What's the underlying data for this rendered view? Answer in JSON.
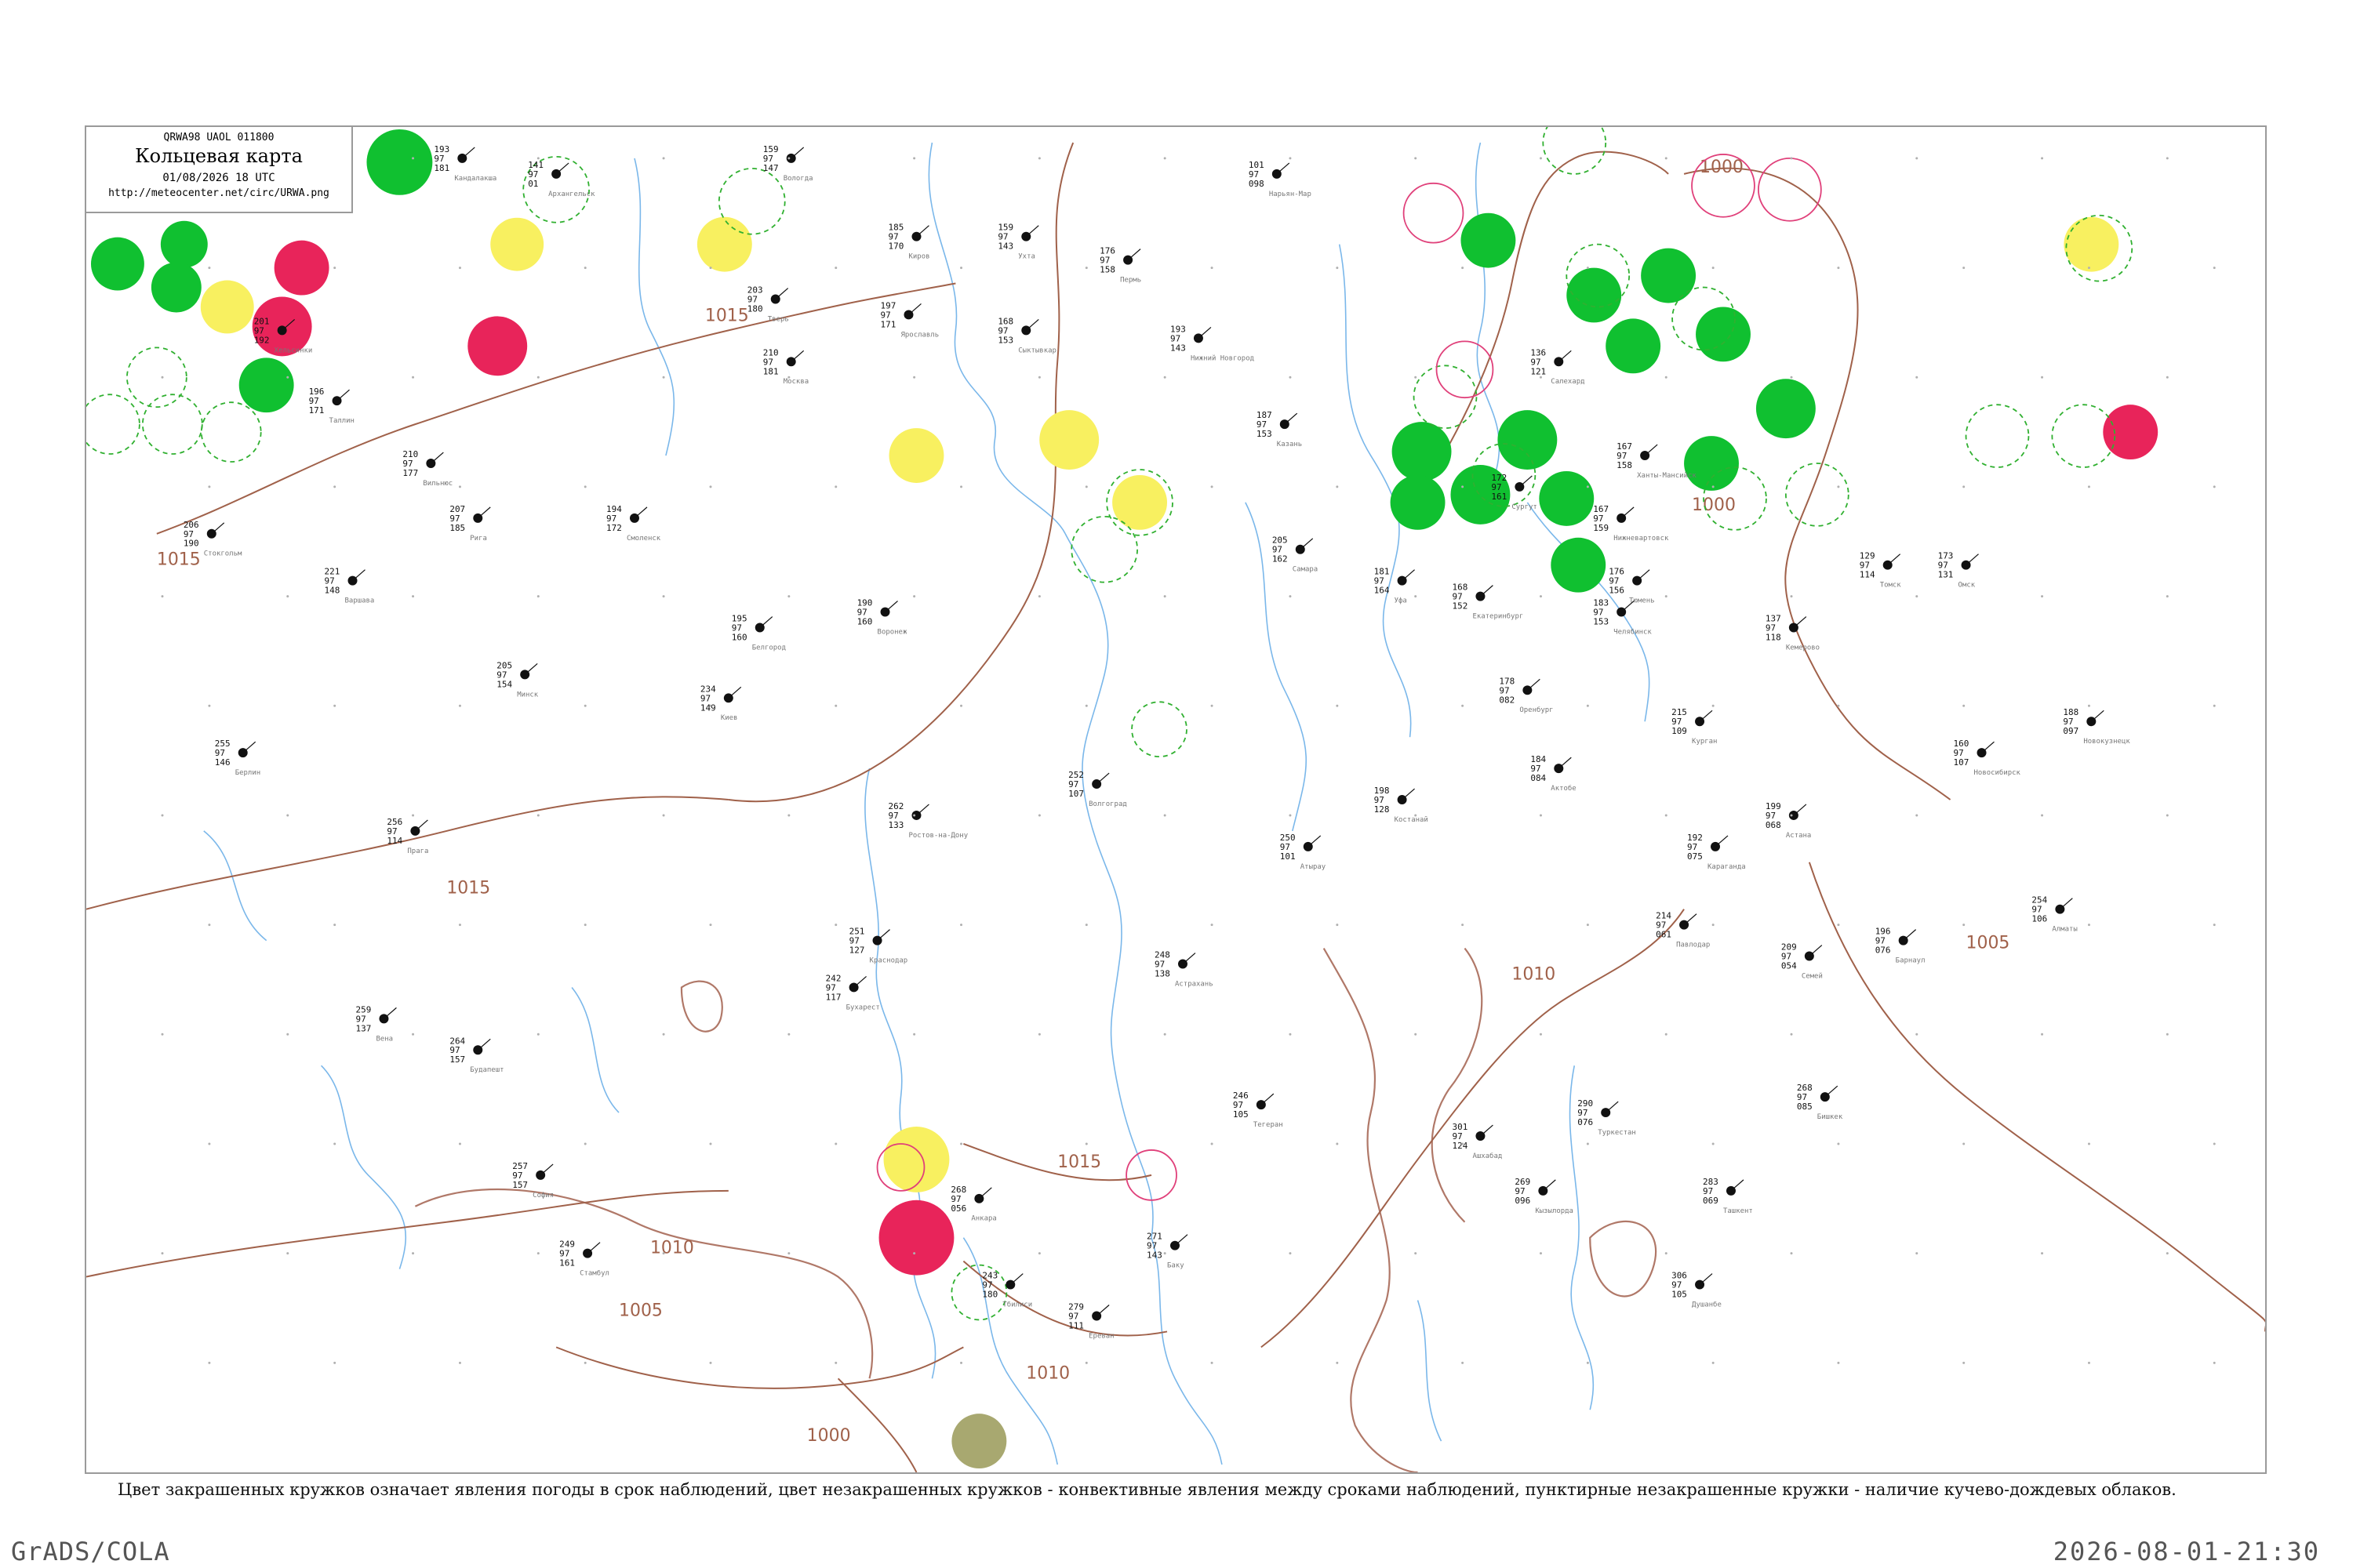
{
  "header": {
    "code": "QRWA98  UAOL  011800",
    "title": "Кольцевая карта",
    "date": "01/08/2026 18 UTC",
    "url": "http://meteocenter.net/circ/URWA.png"
  },
  "caption": "Цвет закрашенных кружков означает явления погоды в срок наблюдений, цвет незакрашенных кружков - конвективные явления между сроками наблюдений, пунктирные незакрашенные кружки - наличие кучево-дождевых облаков.",
  "footer": {
    "left": "GrADS/COLA",
    "right": "2026-08-01-21:30"
  },
  "colors": {
    "isobar": "#a0614a",
    "river": "#7ab7ea",
    "green": "#10c030",
    "red": "#e8245a",
    "yellow": "#f8f060",
    "olive": "#a8a870",
    "dashed_green": "#30b030",
    "pink": "#e0407a"
  },
  "isobars": [
    {
      "label": "1015"
    },
    {
      "label": "1015"
    },
    {
      "label": "1015"
    },
    {
      "label": "1015"
    },
    {
      "label": "1010"
    },
    {
      "label": "1010"
    },
    {
      "label": "1010"
    },
    {
      "label": "1005"
    },
    {
      "label": "1005"
    },
    {
      "label": "1000"
    },
    {
      "label": "1000"
    },
    {
      "label": "1000"
    }
  ],
  "stations": [
    {
      "name": "Кандалакша",
      "t": "193",
      "td": "181",
      "p": "97"
    },
    {
      "name": "Архангельск",
      "t": "141",
      "td": "01",
      "p": "97"
    },
    {
      "name": "Вологда",
      "t": "159",
      "td": "147",
      "p": "97"
    },
    {
      "name": "Киров",
      "t": "185",
      "td": "170",
      "p": "97"
    },
    {
      "name": "Пермь",
      "t": "176",
      "td": "158",
      "p": "97"
    },
    {
      "name": "Сыктывкар",
      "t": "168",
      "td": "153",
      "p": "97"
    },
    {
      "name": "Ухта",
      "t": "159",
      "td": "143",
      "p": "97"
    },
    {
      "name": "Нарьян-Мар",
      "t": "101",
      "td": "098",
      "p": "97"
    },
    {
      "name": "Москва",
      "t": "210",
      "td": "181",
      "p": "97"
    },
    {
      "name": "Смоленск",
      "t": "194",
      "td": "172",
      "p": "97"
    },
    {
      "name": "Тверь",
      "t": "203",
      "td": "180",
      "p": "97"
    },
    {
      "name": "Ярославль",
      "t": "197",
      "td": "171",
      "p": "97"
    },
    {
      "name": "Нижний Новгород",
      "t": "193",
      "td": "143",
      "p": "97"
    },
    {
      "name": "Казань",
      "t": "187",
      "td": "153",
      "p": "97"
    },
    {
      "name": "Самара",
      "t": "205",
      "td": "162",
      "p": "97"
    },
    {
      "name": "Оренбург",
      "t": "178",
      "td": "082",
      "p": "97"
    },
    {
      "name": "Уфа",
      "t": "181",
      "td": "164",
      "p": "97"
    },
    {
      "name": "Екатеринбург",
      "t": "168",
      "td": "152",
      "p": "97"
    },
    {
      "name": "Тюмень",
      "t": "176",
      "td": "156",
      "p": "97"
    },
    {
      "name": "Омск",
      "t": "173",
      "td": "131",
      "p": "97"
    },
    {
      "name": "Курган",
      "t": "215",
      "td": "109",
      "p": "97"
    },
    {
      "name": "Челябинск",
      "t": "183",
      "td": "153",
      "p": "97"
    },
    {
      "name": "Воронеж",
      "t": "190",
      "td": "160",
      "p": "97"
    },
    {
      "name": "Белгород",
      "t": "195",
      "td": "160",
      "p": "97"
    },
    {
      "name": "Ростов-на-Дону",
      "t": "262",
      "td": "133",
      "p": "97"
    },
    {
      "name": "Волгоград",
      "t": "252",
      "td": "107",
      "p": "97"
    },
    {
      "name": "Астрахань",
      "t": "248",
      "td": "138",
      "p": "97"
    },
    {
      "name": "Краснодар",
      "t": "251",
      "td": "127",
      "p": "97"
    },
    {
      "name": "Минск",
      "t": "205",
      "td": "154",
      "p": "97"
    },
    {
      "name": "Киев",
      "t": "234",
      "td": "149",
      "p": "97"
    },
    {
      "name": "Варшава",
      "t": "221",
      "td": "148",
      "p": "97"
    },
    {
      "name": "Рига",
      "t": "207",
      "td": "185",
      "p": "97"
    },
    {
      "name": "Вильнюс",
      "t": "210",
      "td": "177",
      "p": "97"
    },
    {
      "name": "Таллин",
      "t": "196",
      "td": "171",
      "p": "97"
    },
    {
      "name": "Хельсинки",
      "t": "201",
      "td": "192",
      "p": "97"
    },
    {
      "name": "Стокгольм",
      "t": "206",
      "td": "190",
      "p": "97"
    },
    {
      "name": "Берлин",
      "t": "255",
      "td": "146",
      "p": "97"
    },
    {
      "name": "Прага",
      "t": "256",
      "td": "114",
      "p": "97"
    },
    {
      "name": "Вена",
      "t": "259",
      "td": "137",
      "p": "97"
    },
    {
      "name": "Будапешт",
      "t": "264",
      "td": "157",
      "p": "97"
    },
    {
      "name": "Бухарест",
      "t": "242",
      "td": "117",
      "p": "97"
    },
    {
      "name": "София",
      "t": "257",
      "td": "157",
      "p": "97"
    },
    {
      "name": "Стамбул",
      "t": "249",
      "td": "161",
      "p": "97"
    },
    {
      "name": "Анкара",
      "t": "268",
      "td": "056",
      "p": "97"
    },
    {
      "name": "Тбилиси",
      "t": "243",
      "td": "180",
      "p": "97"
    },
    {
      "name": "Ереван",
      "t": "279",
      "td": "111",
      "p": "97"
    },
    {
      "name": "Баку",
      "t": "271",
      "td": "143",
      "p": "97"
    },
    {
      "name": "Тегеран",
      "t": "246",
      "td": "105",
      "p": "97"
    },
    {
      "name": "Ашхабад",
      "t": "301",
      "td": "124",
      "p": "97"
    },
    {
      "name": "Атырау",
      "t": "250",
      "td": "101",
      "p": "97"
    },
    {
      "name": "Актобе",
      "t": "184",
      "td": "084",
      "p": "97"
    },
    {
      "name": "Костанай",
      "t": "198",
      "td": "128",
      "p": "97"
    },
    {
      "name": "Астана",
      "t": "199",
      "td": "068",
      "p": "97"
    },
    {
      "name": "Караганда",
      "t": "192",
      "td": "075",
      "p": "97"
    },
    {
      "name": "Павлодар",
      "t": "214",
      "td": "061",
      "p": "97"
    },
    {
      "name": "Семей",
      "t": "209",
      "td": "054",
      "p": "97"
    },
    {
      "name": "Барнаул",
      "t": "196",
      "td": "076",
      "p": "97"
    },
    {
      "name": "Новосибирск",
      "t": "160",
      "td": "107",
      "p": "97"
    },
    {
      "name": "Томск",
      "t": "129",
      "td": "114",
      "p": "97"
    },
    {
      "name": "Кемерово",
      "t": "137",
      "td": "118",
      "p": "97"
    },
    {
      "name": "Новокузнецк",
      "t": "188",
      "td": "097",
      "p": "97"
    },
    {
      "name": "Алматы",
      "t": "254",
      "td": "106",
      "p": "97"
    },
    {
      "name": "Бишкек",
      "t": "268",
      "td": "085",
      "p": "97"
    },
    {
      "name": "Ташкент",
      "t": "283",
      "td": "069",
      "p": "97"
    },
    {
      "name": "Душанбе",
      "t": "306",
      "td": "105",
      "p": "97"
    },
    {
      "name": "Туркестан",
      "t": "290",
      "td": "076",
      "p": "97"
    },
    {
      "name": "Кызылорда",
      "t": "269",
      "td": "096",
      "p": "97"
    },
    {
      "name": "Салехард",
      "t": "136",
      "td": "121",
      "p": "97"
    },
    {
      "name": "Ханты-Мансийск",
      "t": "167",
      "td": "158",
      "p": "97"
    },
    {
      "name": "Сургут",
      "t": "172",
      "td": "161",
      "p": "97"
    },
    {
      "name": "Нижневартовск",
      "t": "167",
      "td": "159",
      "p": "97"
    }
  ]
}
